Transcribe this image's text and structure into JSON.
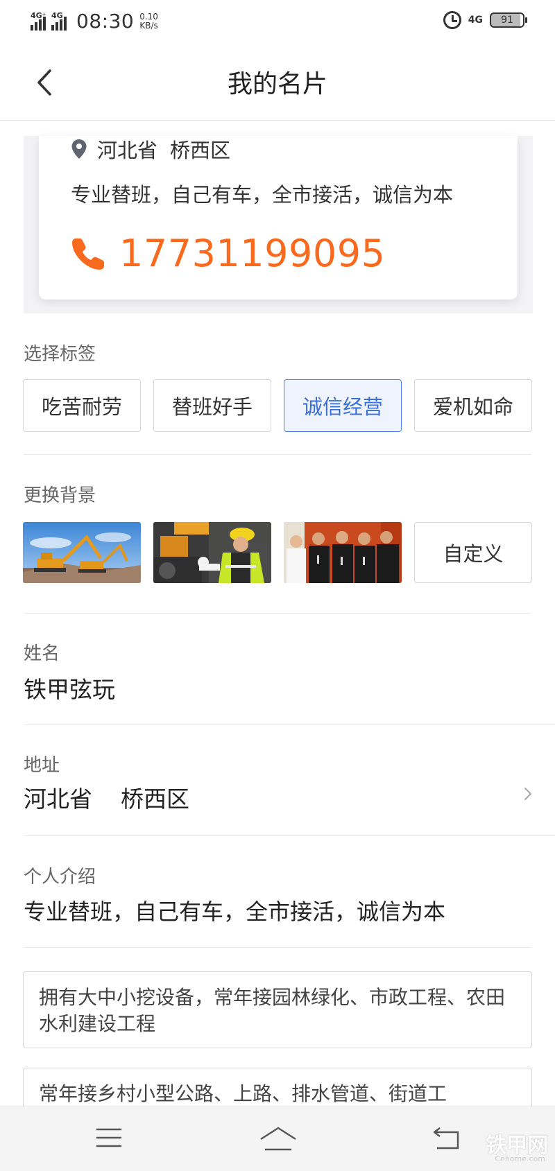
{
  "status_bar": {
    "signal_1": "4G⁺",
    "signal_2": "4G",
    "time": "08:30",
    "speed_value": "0.10",
    "speed_unit": "KB/s",
    "network": "4G",
    "battery": "91"
  },
  "header": {
    "title": "我的名片"
  },
  "card": {
    "province": "河北省",
    "district": "桥西区",
    "intro": "专业替班，自己有车，全市接活，诚信为本",
    "phone": "17731199095",
    "phone_color": "#fa6a1e"
  },
  "tags": {
    "label": "选择标签",
    "items": [
      "吃苦耐劳",
      "替班好手",
      "诚信经营",
      "爱机如命"
    ],
    "selected": "诚信经营",
    "accent_color": "#3a6fd8"
  },
  "background": {
    "label": "更换背景",
    "custom_label": "自定义"
  },
  "name_field": {
    "label": "姓名",
    "value": "铁甲弦玩"
  },
  "address_field": {
    "label": "地址",
    "province": "河北省",
    "district": "桥西区"
  },
  "intro_field": {
    "label": "个人介绍",
    "value": "专业替班，自己有车，全市接活，诚信为本",
    "suggestions": [
      "拥有大中小挖设备，常年接园林绿化、市政工程、农田水利建设工程",
      "常年接乡村小型公路、上路、排水管道、街道工"
    ]
  },
  "bottom_nav": {
    "menu_icon": "menu-icon",
    "home_icon": "home-icon",
    "back_icon": "return-icon",
    "watermark": "铁甲网",
    "watermark_sub": "Cehome.com"
  }
}
